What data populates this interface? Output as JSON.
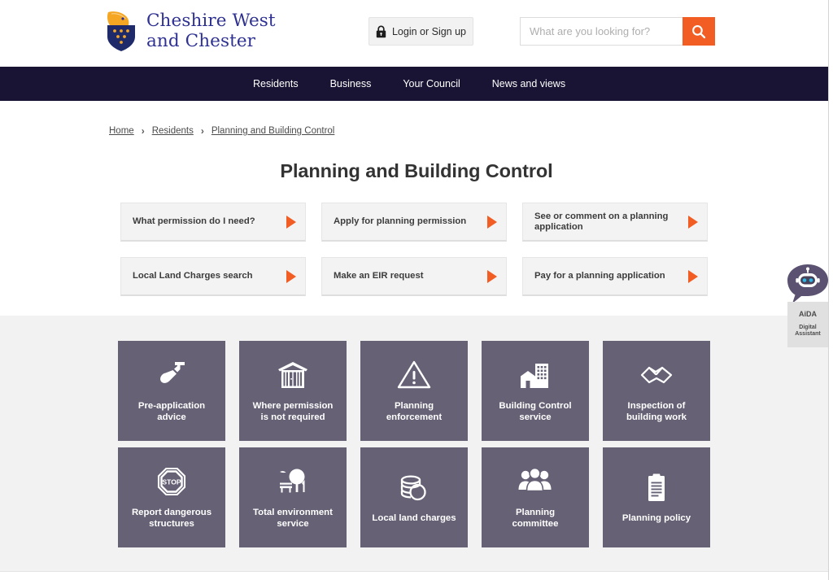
{
  "header": {
    "logo": {
      "name": "Cheshire West\nand Chester",
      "crest_icon": "cheshire-west-chester-crest",
      "shield_color": "#2e3191",
      "crest_color": "#f5a623"
    },
    "login_button": {
      "label": "Login or Sign up",
      "icon": "lock-icon"
    },
    "search": {
      "placeholder": "What are you looking for?",
      "value": "",
      "button_icon": "search-icon",
      "button_color": "#f15d22"
    }
  },
  "nav": {
    "background": "#191433",
    "items": [
      {
        "label": "Residents"
      },
      {
        "label": "Business"
      },
      {
        "label": "Your Council"
      },
      {
        "label": "News and views"
      }
    ]
  },
  "breadcrumb": {
    "separator": "›",
    "items": [
      {
        "label": "Home"
      },
      {
        "label": "Residents"
      },
      {
        "label": "Planning and Building Control"
      }
    ]
  },
  "main": {
    "title": "Planning and Building Control",
    "link_cards": [
      {
        "label": "What permission do I need?",
        "arrow_icon": "triangle-right-icon"
      },
      {
        "label": "Apply for planning permission",
        "arrow_icon": "triangle-right-icon"
      },
      {
        "label": "See or comment on a planning application",
        "arrow_icon": "triangle-right-icon"
      },
      {
        "label": "Local Land Charges search",
        "arrow_icon": "triangle-right-icon"
      },
      {
        "label": "Make an EIR request",
        "arrow_icon": "triangle-right-icon"
      },
      {
        "label": "Pay for a planning application",
        "arrow_icon": "triangle-right-icon"
      }
    ],
    "tiles_background": "#f2f2f2",
    "tile_color": "#666175",
    "tiles": [
      {
        "label": "Pre-application\nadvice",
        "icon": "shovel-icon"
      },
      {
        "label": "Where permission\nis not required",
        "icon": "shed-icon"
      },
      {
        "label": "Planning\nenforcement",
        "icon": "warning-triangle-icon"
      },
      {
        "label": "Building Control\nservice",
        "icon": "buildings-icon"
      },
      {
        "label": "Inspection of\nbuilding work",
        "icon": "handshake-icon"
      },
      {
        "label": "Report dangerous\nstructures",
        "icon": "stop-sign-icon"
      },
      {
        "label": "Total environment\nservice",
        "icon": "tree-park-icon"
      },
      {
        "label": "Local land charges",
        "icon": "coins-icon"
      },
      {
        "label": "Planning\ncommittee",
        "icon": "people-group-icon"
      },
      {
        "label": "Planning policy",
        "icon": "clipboard-icon"
      }
    ]
  },
  "chat_widget": {
    "name": "AiDA",
    "subtitle": "Digital\nAssistant",
    "icon": "robot-chat-icon",
    "color": "#5b5170"
  }
}
